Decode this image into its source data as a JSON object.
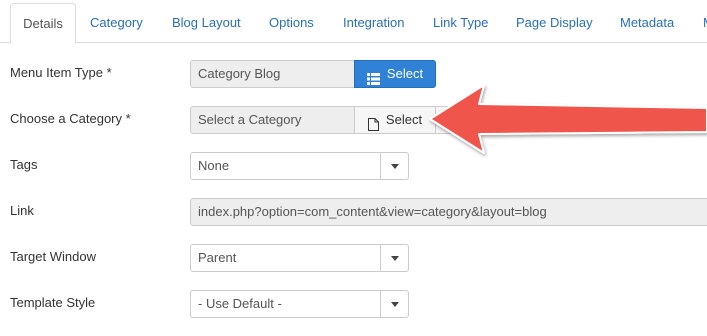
{
  "tabs": [
    {
      "label": "Details",
      "active": true
    },
    {
      "label": "Category",
      "active": false
    },
    {
      "label": "Blog Layout",
      "active": false
    },
    {
      "label": "Options",
      "active": false
    },
    {
      "label": "Integration",
      "active": false
    },
    {
      "label": "Link Type",
      "active": false
    },
    {
      "label": "Page Display",
      "active": false
    },
    {
      "label": "Metadata",
      "active": false
    },
    {
      "label": "M",
      "active": false
    }
  ],
  "form": {
    "menu_item_type": {
      "label": "Menu Item Type *",
      "value": "Category Blog",
      "button_label": "Select",
      "button_icon": "list-icon"
    },
    "choose_category": {
      "label": "Choose a Category *",
      "placeholder": "Select a Category",
      "button_label": "Select",
      "button_icon": "file-icon"
    },
    "tags": {
      "label": "Tags",
      "value": "None"
    },
    "link": {
      "label": "Link",
      "value": "index.php?option=com_content&view=category&layout=blog"
    },
    "target_window": {
      "label": "Target Window",
      "value": "Parent"
    },
    "template_style": {
      "label": "Template Style",
      "value": "- Use Default -"
    }
  },
  "colors": {
    "accent": "#2f82d6",
    "tab_link": "#2a6fb7",
    "arrow": "#f0544b"
  }
}
